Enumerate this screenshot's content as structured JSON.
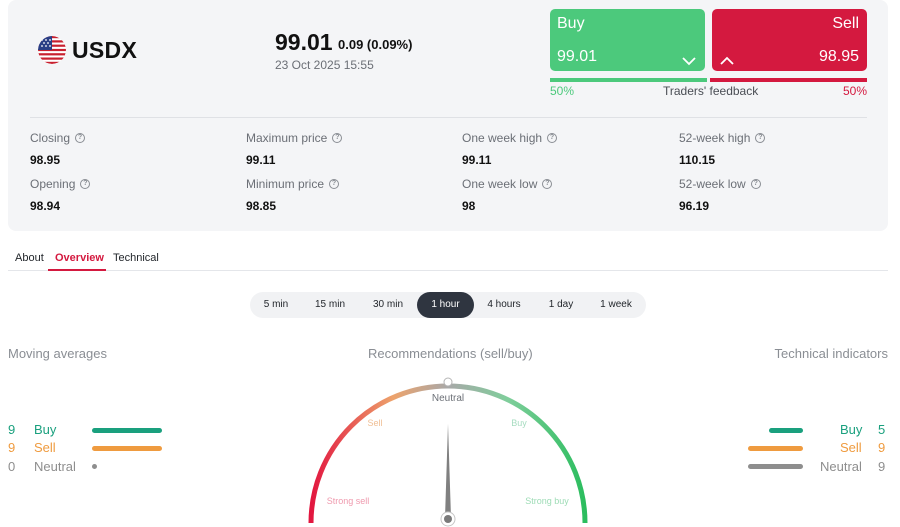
{
  "instrument": {
    "symbol": "USDX",
    "price": "99.01",
    "change": "0.09 (0.09%)",
    "datetime": "23 Oct 2025 15:55",
    "flag_icon": "us-flag-icon"
  },
  "trade": {
    "buy_label": "Buy",
    "buy_price": "99.01",
    "sell_label": "Sell",
    "sell_price": "98.95",
    "feedback_label": "Traders' feedback",
    "buy_pct": "50%",
    "sell_pct": "50%",
    "buy_share": 0.5,
    "sell_share": 0.5
  },
  "stats": [
    {
      "label": "Closing",
      "value": "98.95"
    },
    {
      "label": "Maximum price",
      "value": "99.11"
    },
    {
      "label": "One week high",
      "value": "99.11"
    },
    {
      "label": "52-week high",
      "value": "110.15"
    },
    {
      "label": "Opening",
      "value": "98.94"
    },
    {
      "label": "Minimum price",
      "value": "98.85"
    },
    {
      "label": "One week low",
      "value": "98"
    },
    {
      "label": "52-week low",
      "value": "96.19"
    }
  ],
  "tabs": [
    "About",
    "Overview",
    "Technical"
  ],
  "active_tab": "Overview",
  "periods": [
    "5 min",
    "15 min",
    "30 min",
    "1 hour",
    "4 hours",
    "1 day",
    "1 week"
  ],
  "active_period": "1 hour",
  "moving_averages": {
    "title": "Moving averages",
    "rows": [
      {
        "count": "9",
        "label": "Buy"
      },
      {
        "count": "9",
        "label": "Sell"
      },
      {
        "count": "0",
        "label": "Neutral"
      }
    ]
  },
  "technical_indicators": {
    "title": "Technical indicators",
    "rows": [
      {
        "count": "5",
        "label": "Buy"
      },
      {
        "count": "9",
        "label": "Sell"
      },
      {
        "count": "9",
        "label": "Neutral"
      }
    ]
  },
  "recommendations": {
    "title": "Recommendations (sell/buy)",
    "labels": {
      "neutral": "Neutral",
      "sell": "Sell",
      "buy": "Buy",
      "strong_sell": "Strong sell",
      "strong_buy": "Strong buy"
    },
    "needle_position": 0.5
  },
  "colors": {
    "buy": "#4cc97c",
    "sell": "#d4193f",
    "indicator_buy": "#1aa07e",
    "indicator_sell": "#ef9b3f",
    "indicator_neutral": "#8e8e8e",
    "tab_active": "#d4193f",
    "period_active": "#2f3540"
  }
}
